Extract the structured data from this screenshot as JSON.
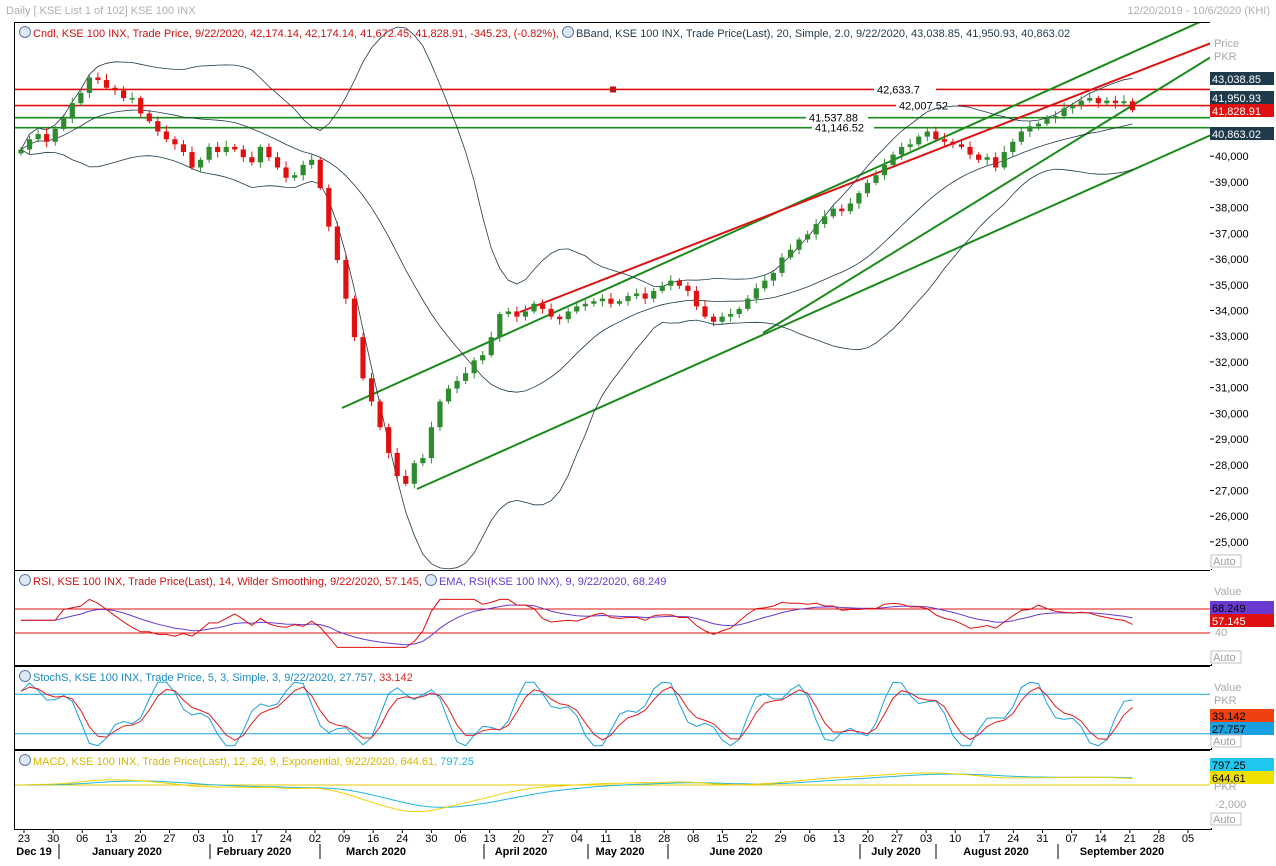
{
  "window": {
    "title": "Daily [.KSE List 1 of 102] KSE 100 INX",
    "date_range": "12/20/2019 - 10/6/2020 (KHI)"
  },
  "price_panel": {
    "legend_candle": "Cndl, KSE 100 INX, Trade Price, 9/22/2020, 42,174.14, 42,174.14, 41,672.45, 41,828.91, -345.23, (-0.82%),",
    "legend_bband": "BBand, KSE 100 INX, Trade Price(Last), 20, Simple, 2.0, 9/22/2020, 43,038.85, 41,950.93, 40,863.02",
    "axis_title": "Price",
    "axis_unit": "PKR",
    "auto_label": "Auto",
    "ticks": [
      "40,000",
      "39,000",
      "38,000",
      "37,000",
      "36,000",
      "35,000",
      "34,000",
      "33,000",
      "32,000",
      "31,000",
      "30,000",
      "29,000",
      "28,000",
      "27,000",
      "26,000",
      "25,000"
    ],
    "tags": {
      "bb_upper": "43,038.85",
      "bb_mid": "41,950.93",
      "last": "41,828.91",
      "bb_lower": "40,863.02"
    },
    "level_labels": [
      "42,633.7",
      "42,007.52",
      "41,537.88",
      "41,146.52"
    ]
  },
  "rsi_panel": {
    "legend_rsi": "RSI, KSE 100 INX, Trade Price(Last), 14, Wilder Smoothing, 9/22/2020, 57.145,",
    "legend_ema": "EMA, RSI(KSE 100 INX), 9, 9/22/2020, 68.249",
    "axis_title": "Value",
    "ticks": [
      "40"
    ],
    "tags": {
      "ema": "68.249",
      "rsi": "57.145"
    },
    "auto_label": "Auto"
  },
  "stoch_panel": {
    "legend": "StochS, KSE 100 INX, Trade Price, 5, 3, Simple, 3, 9/22/2020, 27.757,",
    "legend_d": "33.142",
    "axis_title": "Value",
    "axis_unit": "PKR",
    "tags": {
      "d": "33.142",
      "k": "27.757"
    },
    "auto_label": "Auto"
  },
  "macd_panel": {
    "legend": "MACD, KSE 100 INX, Trade Price(Last), 12, 26, 9, Exponential, 9/22/2020, 644.61,",
    "legend_signal": "797.25",
    "axis_unit": "PKR",
    "ticks": [
      "-2,000"
    ],
    "tags": {
      "signal": "797.25",
      "macd": "644.61"
    },
    "auto_label": "Auto"
  },
  "x_axis": {
    "days": [
      "23",
      "30",
      "06",
      "13",
      "20",
      "27",
      "03",
      "10",
      "17",
      "24",
      "02",
      "09",
      "16",
      "24",
      "30",
      "06",
      "13",
      "20",
      "27",
      "04",
      "11",
      "18",
      "28",
      "08",
      "15",
      "22",
      "29",
      "06",
      "13",
      "20",
      "27",
      "03",
      "10",
      "17",
      "24",
      "31",
      "07",
      "14",
      "21",
      "28",
      "05"
    ],
    "months": [
      "Dec 19",
      "January 2020",
      "February 2020",
      "March 2020",
      "April 2020",
      "May 2020",
      "June 2020",
      "July 2020",
      "August 2020",
      "September 2020"
    ]
  },
  "colors": {
    "up": "#2e8b2e",
    "down": "#e01010",
    "red_line": "#e01010",
    "green_line": "#1a8a1a",
    "bband": "#1f3a4a",
    "rsi": "#e01010",
    "ema": "#6a3ad0",
    "stoch_k": "#1aa0e0",
    "stoch_d": "#e02020",
    "macd": "#f0d000",
    "signal": "#20b8e0"
  },
  "chart_data": {
    "type": "candlestick",
    "instrument": "KSE 100 INX",
    "closes": [
      40300,
      40700,
      40900,
      40600,
      41100,
      41500,
      42100,
      42500,
      43100,
      43000,
      42700,
      42600,
      42300,
      42300,
      41700,
      41400,
      41000,
      40700,
      40500,
      40200,
      39600,
      39900,
      40400,
      40200,
      40400,
      40300,
      40000,
      39800,
      40400,
      40000,
      39600,
      39200,
      39300,
      39700,
      39900,
      38800,
      37300,
      36000,
      34500,
      33000,
      31400,
      30500,
      29500,
      28500,
      27600,
      27300,
      28100,
      28300,
      29500,
      30500,
      31000,
      31300,
      31600,
      32100,
      32300,
      33000,
      33900,
      34000,
      33800,
      34000,
      34300,
      34100,
      33800,
      33700,
      34000,
      34200,
      34300,
      34400,
      34500,
      34300,
      34400,
      34600,
      34700,
      34500,
      34800,
      35000,
      35200,
      35000,
      34800,
      34200,
      33800,
      33600,
      33800,
      33900,
      34100,
      34500,
      34900,
      35200,
      35500,
      36100,
      36400,
      36800,
      37000,
      37400,
      37700,
      38000,
      37900,
      38200,
      38600,
      39000,
      39300,
      39700,
      40100,
      40400,
      40500,
      40800,
      41000,
      40700,
      40600,
      40500,
      40400,
      40100,
      39900,
      40000,
      39600,
      40200,
      40600,
      41000,
      41200,
      41300,
      41500,
      41600,
      41900,
      42000,
      42200,
      42300,
      42100,
      42200,
      42100,
      42174,
      41829
    ],
    "bband": {
      "upper": "43,038.85",
      "middle": "41,950.93",
      "lower": "40,863.02"
    },
    "levels": [
      42633.7,
      42007.52,
      41537.88,
      41146.52
    ],
    "ylim": [
      25000,
      43500
    ]
  }
}
